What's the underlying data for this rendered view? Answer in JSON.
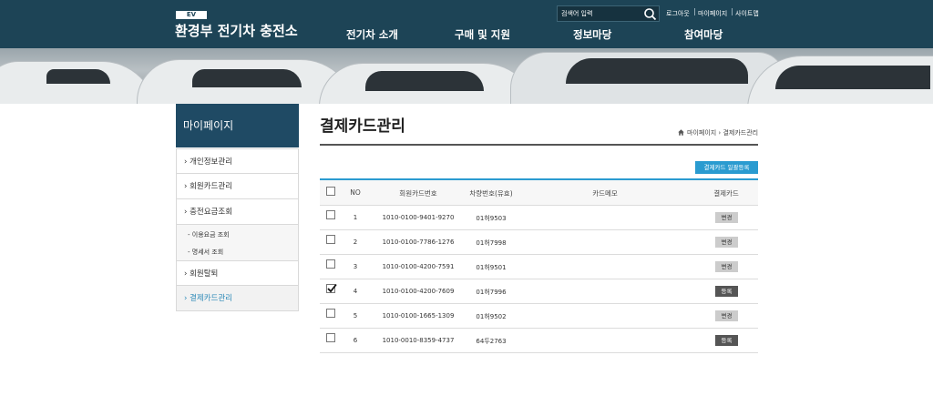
{
  "header": {
    "logo_badge": "EV",
    "site_title": "환경부 전기차 충전소",
    "search_placeholder": "검색어 입력",
    "util": [
      "로그아웃",
      "마이페이지",
      "사이트맵"
    ],
    "nav": [
      "전기차 소개",
      "구매 및 지원",
      "정보마당",
      "참여마당"
    ]
  },
  "sidebar": {
    "title": "마이페이지",
    "items": [
      "› 개인정보관리",
      "› 회원카드관리",
      "› 충전요금조회",
      "› 회원탈퇴",
      "› 결제카드관리"
    ],
    "sub_items": [
      "- 이용요금 조회",
      "- 명세서 조회"
    ]
  },
  "main": {
    "title": "결제카드관리",
    "breadcrumb": "마이페이지 › 결제카드관리",
    "register_button": "결제카드 일괄등록"
  },
  "table": {
    "headers": [
      "NO",
      "회원카드번호",
      "차량번호(유효)",
      "카드메모",
      "결제카드"
    ],
    "rows": [
      {
        "no": "1",
        "card": "1010-0100-9401-9270",
        "car": "01허9503",
        "memo": "",
        "checked": false,
        "action": "변경"
      },
      {
        "no": "2",
        "card": "1010-0100-7786-1276",
        "car": "01허7998",
        "memo": "",
        "checked": false,
        "action": "변경"
      },
      {
        "no": "3",
        "card": "1010-0100-4200-7591",
        "car": "01허9501",
        "memo": "",
        "checked": false,
        "action": "변경"
      },
      {
        "no": "4",
        "card": "1010-0100-4200-7609",
        "car": "01허7996",
        "memo": "",
        "checked": true,
        "action": "등록"
      },
      {
        "no": "5",
        "card": "1010-0100-1665-1309",
        "car": "01허9502",
        "memo": "",
        "checked": false,
        "action": "변경"
      },
      {
        "no": "6",
        "card": "1010-0010-8359-4737",
        "car": "64두2763",
        "memo": "",
        "checked": false,
        "action": "등록"
      }
    ]
  },
  "colors": {
    "header_bg": "#1d4456",
    "sidebar_title_bg": "#1f4a64",
    "accent": "#2a9bd0",
    "active_menu_text": "#2e8ab8",
    "change_button": "#cccccc",
    "register_button": "#555555"
  }
}
